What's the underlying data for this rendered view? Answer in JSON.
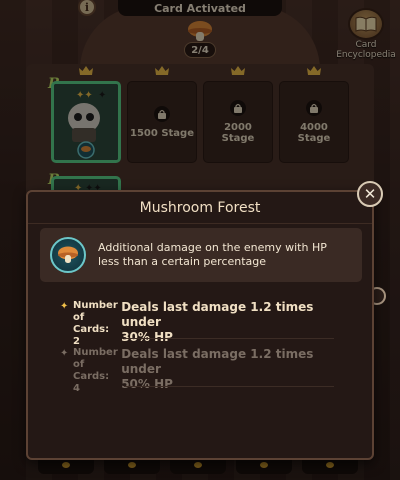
{
  "header": {
    "title": "Card Activated",
    "progress": "2/4"
  },
  "encyclopedia": {
    "label": "Card\nEncyclopedia"
  },
  "cards": {
    "row1_grade": "B",
    "row2_grade": "B",
    "slots": [
      {
        "text": "1500 Stage"
      },
      {
        "text": "2000\nStage"
      },
      {
        "text": "4000\nStage"
      }
    ]
  },
  "modal": {
    "title": "Mushroom Forest",
    "description": "Additional damage on the enemy with HP less than a certain percentage",
    "tiers": [
      {
        "label": "Number\nof Cards:\n2",
        "desc_line1": "Deals last damage 1.2 times under",
        "desc_line2": "30% HP",
        "active": true
      },
      {
        "label": "Number\nof Cards:\n4",
        "desc_line1": "Deals last damage 1.2 times under",
        "desc_line2": "50% HP",
        "active": false
      }
    ],
    "close_icon": "close-icon"
  },
  "colors": {
    "accent_green": "#5bd38a",
    "gold": "#f1c04a",
    "mushroom_orange": "#e08a3a",
    "teal": "#6cc7c9"
  }
}
